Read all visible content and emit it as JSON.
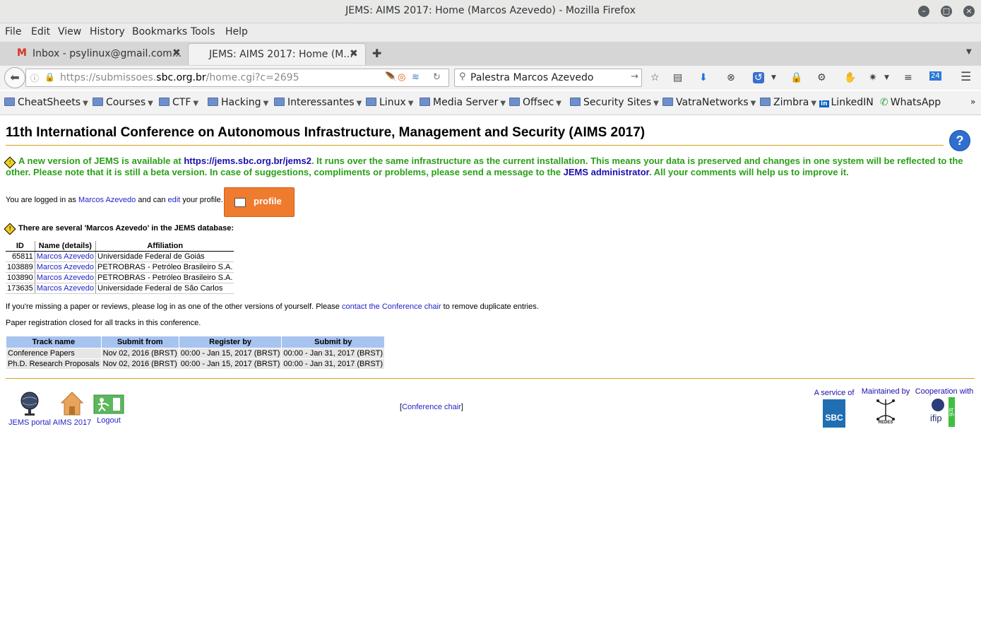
{
  "window": {
    "title": "JEMS: AIMS 2017: Home (Marcos Azevedo) - Mozilla Firefox"
  },
  "menu": [
    "File",
    "Edit",
    "View",
    "History",
    "Bookmarks",
    "Tools",
    "Help"
  ],
  "tabs": [
    {
      "label": "Inbox - psylinux@gmail.com...",
      "active": false
    },
    {
      "label": "JEMS: AIMS 2017: Home (M...",
      "active": true
    }
  ],
  "nav": {
    "url_prefix": "https://submissoes.",
    "url_domain": "sbc.org.br",
    "url_suffix": "/home.cgi?c=2695",
    "search_value": "Palestra Marcos Azevedo",
    "calendar_day": "24"
  },
  "bookmarks": [
    "CheatSheets",
    "Courses",
    "CTF",
    "Hacking",
    "Interessantes",
    "Linux",
    "Media Server",
    "Offsec",
    "Security Sites",
    "VatraNetworks",
    "Zimbra",
    "LinkedIN",
    "WhatsApp"
  ],
  "page": {
    "heading": "11th International Conference on Autonomous Infrastructure, Management and Security (AIMS 2017)",
    "notice_1": "A new version of JEMS is available at ",
    "notice_link": "https://jems.sbc.org.br/jems2",
    "notice_2": ". It runs over the same infrastructure as the current installation. This means your data is preserved and changes in one system will be reflected to the other. Please note that it is still a beta version. In case of suggestions, compliments or problems, please send a message to the ",
    "notice_admin": "JEMS administrator",
    "notice_3": ". All your comments will help us to improve it.",
    "logged_1": "You are logged in as ",
    "logged_user": "Marcos Azevedo",
    "logged_2": " and can ",
    "logged_edit": "edit",
    "logged_3": " your profile.",
    "profile_button": "profile",
    "several_warning": "There are several 'Marcos Azevedo' in the JEMS database:",
    "id_table": {
      "headers": [
        "ID",
        "Name (details)",
        "Affiliation"
      ],
      "rows": [
        [
          "65811",
          "Marcos Azevedo",
          "Universidade Federal de Goiás"
        ],
        [
          "103889",
          "Marcos Azevedo",
          "PETROBRAS - Petróleo Brasileiro S.A."
        ],
        [
          "103890",
          "Marcos Azevedo",
          "PETROBRAS - Petróleo Brasileiro S.A."
        ],
        [
          "173635",
          "Marcos Azevedo",
          "Universidade Federal de São Carlos"
        ]
      ]
    },
    "missing_1": "If you're missing a paper or reviews, please log in as one of the other versions of yourself. Please ",
    "missing_link": "contact the Conference chair",
    "missing_2": " to remove duplicate entries.",
    "closed": "Paper registration closed for all tracks in this conference.",
    "track_table": {
      "headers": [
        "Track name",
        "Submit from",
        "Register by",
        "Submit by"
      ],
      "rows": [
        [
          "Conference Papers",
          "Nov 02, 2016 (BRST)",
          "00:00 - Jan 15, 2017 (BRST)",
          "00:00 - Jan 31, 2017 (BRST)"
        ],
        [
          "Ph.D. Research Proposals",
          "Nov 02, 2016 (BRST)",
          "00:00 - Jan 15, 2017 (BRST)",
          "00:00 - Jan 31, 2017 (BRST)"
        ]
      ]
    },
    "footer": {
      "jems_portal": "JEMS portal",
      "aims": "AIMS 2017",
      "logout": "Logout",
      "chair_open": "[",
      "chair_link": "Conference chair",
      "chair_close": "]",
      "service_of": "A service of",
      "sbc": "SBC",
      "maintained_by": "Maintained by",
      "redes": "REDES",
      "cooperation": "Cooperation with",
      "ifip": "ifip",
      "tc": "tc6"
    }
  }
}
